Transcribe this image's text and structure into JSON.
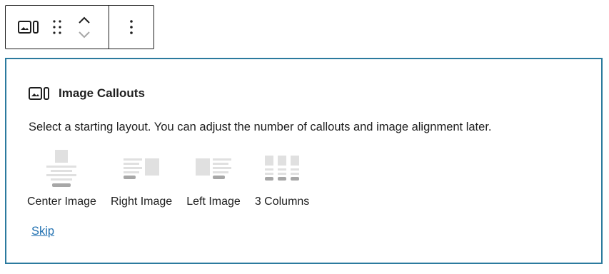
{
  "toolbar": {
    "block_icon": "image-callout-icon",
    "drag_icon": "drag-handle-icon",
    "move_up_icon": "chevron-up-icon",
    "move_down_icon": "chevron-down-icon",
    "more_icon": "more-vertical-icon"
  },
  "block": {
    "title": "Image Callouts",
    "title_icon": "image-callout-icon",
    "instructions": "Select a starting layout. You can adjust the number of callouts and image alignment later.",
    "options": [
      {
        "label": "Center Image",
        "icon": "layout-center-image-icon"
      },
      {
        "label": "Right Image",
        "icon": "layout-right-image-icon"
      },
      {
        "label": "Left Image",
        "icon": "layout-left-image-icon"
      },
      {
        "label": "3 Columns",
        "icon": "layout-3-columns-icon"
      }
    ],
    "skip_label": "Skip"
  },
  "colors": {
    "border_accent": "#2b7a9e",
    "link": "#2271b1",
    "text": "#1e1e1e",
    "placeholder_light": "#e0e0e0",
    "placeholder_dark": "#a7a7a7"
  }
}
